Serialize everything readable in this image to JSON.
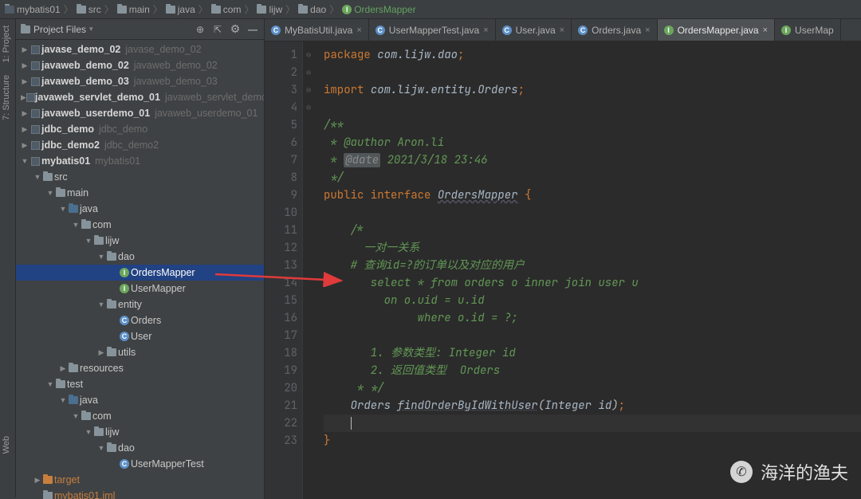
{
  "breadcrumbs": [
    "mybatis01",
    "src",
    "main",
    "java",
    "com",
    "lijw",
    "dao",
    "OrdersMapper"
  ],
  "leftTabs": [
    "1: Project",
    "7: Structure",
    "Web"
  ],
  "projectHeader": {
    "title": "Project Files"
  },
  "tree": [
    {
      "depth": 0,
      "arrow": "▶",
      "icon": "module",
      "name": "javase_demo_02",
      "hint": "javase_demo_02",
      "bold": true
    },
    {
      "depth": 0,
      "arrow": "▶",
      "icon": "module",
      "name": "javaweb_demo_02",
      "hint": "javaweb_demo_02",
      "bold": true
    },
    {
      "depth": 0,
      "arrow": "▶",
      "icon": "module",
      "name": "javaweb_demo_03",
      "hint": "javaweb_demo_03",
      "bold": true
    },
    {
      "depth": 0,
      "arrow": "▶",
      "icon": "module",
      "name": "javaweb_servlet_demo_01",
      "hint": "javaweb_servlet_demo",
      "bold": true
    },
    {
      "depth": 0,
      "arrow": "▶",
      "icon": "module",
      "name": "javaweb_userdemo_01",
      "hint": "javaweb_userdemo_01",
      "bold": true
    },
    {
      "depth": 0,
      "arrow": "▶",
      "icon": "module",
      "name": "jdbc_demo",
      "hint": "jdbc_demo",
      "bold": true
    },
    {
      "depth": 0,
      "arrow": "▶",
      "icon": "module",
      "name": "jdbc_demo2",
      "hint": "jdbc_demo2",
      "bold": true
    },
    {
      "depth": 0,
      "arrow": "▼",
      "icon": "module",
      "name": "mybatis01",
      "hint": "mybatis01",
      "bold": true
    },
    {
      "depth": 1,
      "arrow": "▼",
      "icon": "folder-generic",
      "name": "src"
    },
    {
      "depth": 2,
      "arrow": "▼",
      "icon": "folder-generic",
      "name": "main"
    },
    {
      "depth": 3,
      "arrow": "▼",
      "icon": "folder-blue",
      "name": "java"
    },
    {
      "depth": 4,
      "arrow": "▼",
      "icon": "folder-generic",
      "name": "com"
    },
    {
      "depth": 5,
      "arrow": "▼",
      "icon": "folder-generic",
      "name": "lijw"
    },
    {
      "depth": 6,
      "arrow": "▼",
      "icon": "folder-generic",
      "name": "dao"
    },
    {
      "depth": 7,
      "arrow": "",
      "icon": "interface",
      "name": "OrdersMapper",
      "selected": true
    },
    {
      "depth": 7,
      "arrow": "",
      "icon": "interface",
      "name": "UserMapper"
    },
    {
      "depth": 6,
      "arrow": "▼",
      "icon": "folder-generic",
      "name": "entity"
    },
    {
      "depth": 7,
      "arrow": "",
      "icon": "class",
      "name": "Orders"
    },
    {
      "depth": 7,
      "arrow": "",
      "icon": "class",
      "name": "User"
    },
    {
      "depth": 6,
      "arrow": "▶",
      "icon": "folder-generic",
      "name": "utils"
    },
    {
      "depth": 3,
      "arrow": "▶",
      "icon": "folder-generic",
      "name": "resources"
    },
    {
      "depth": 2,
      "arrow": "▼",
      "icon": "folder-generic",
      "name": "test"
    },
    {
      "depth": 3,
      "arrow": "▼",
      "icon": "folder-blue",
      "name": "java"
    },
    {
      "depth": 4,
      "arrow": "▼",
      "icon": "folder-generic",
      "name": "com"
    },
    {
      "depth": 5,
      "arrow": "▼",
      "icon": "folder-generic",
      "name": "lijw"
    },
    {
      "depth": 6,
      "arrow": "▼",
      "icon": "folder-generic",
      "name": "dao"
    },
    {
      "depth": 7,
      "arrow": "",
      "icon": "class",
      "name": "UserMapperTest"
    },
    {
      "depth": 1,
      "arrow": "▶",
      "icon": "folder-orange",
      "name": "target",
      "orange": true
    },
    {
      "depth": 1,
      "arrow": "",
      "icon": "folder-generic",
      "name": "mybatis01.iml",
      "orange": true
    }
  ],
  "tabs": [
    {
      "label": "MyBatisUtil.java",
      "icon": "class",
      "active": false
    },
    {
      "label": "UserMapperTest.java",
      "icon": "class",
      "active": false
    },
    {
      "label": "User.java",
      "icon": "class",
      "active": false
    },
    {
      "label": "Orders.java",
      "icon": "class",
      "active": false
    },
    {
      "label": "OrdersMapper.java",
      "icon": "interface",
      "active": true
    },
    {
      "label": "UserMap",
      "icon": "interface",
      "active": false,
      "noclose": true
    }
  ],
  "code": {
    "lines": [
      {
        "n": 1,
        "html": "<span class='kw'>package</span> <span class='pkg'>com.lijw.dao</span><span class='semi'>;</span>"
      },
      {
        "n": 2,
        "html": ""
      },
      {
        "n": 3,
        "html": "<span class='kw'>import</span> <span class='pkg'>com.lijw.entity.Orders</span><span class='semi'>;</span>"
      },
      {
        "n": 4,
        "html": ""
      },
      {
        "n": 5,
        "fold": "⊖",
        "html": "<span class='doc'>/**</span>"
      },
      {
        "n": 6,
        "html": "<span class='doc'> * @author Aron.li</span>"
      },
      {
        "n": 7,
        "html": "<span class='doc'> * <span class='tag'>@date</span> 2021/3/18 23:46</span>"
      },
      {
        "n": 8,
        "fold": "⊖",
        "html": "<span class='doc'> */</span>"
      },
      {
        "n": 9,
        "html": "<span class='kw'>public interface</span> <span class='cname'>OrdersMapper</span> <span class='punct'>{</span>"
      },
      {
        "n": 10,
        "html": ""
      },
      {
        "n": 11,
        "fold": "⊖",
        "html": "    <span class='cmt'>/*</span>"
      },
      {
        "n": 12,
        "html": "    <span class='cmt'>  一对一关系</span>"
      },
      {
        "n": 13,
        "html": "    <span class='cmt'># 查询id=?的订单以及对应的用户</span>"
      },
      {
        "n": 14,
        "html": "    <span class='cmt'>   select * from orders o inner join user u</span>"
      },
      {
        "n": 15,
        "html": "    <span class='cmt'>     on o.uid = u.id</span>"
      },
      {
        "n": 16,
        "html": "    <span class='cmt'>          where o.id = ?;</span>"
      },
      {
        "n": 17,
        "html": ""
      },
      {
        "n": 18,
        "html": "    <span class='cmt'>   1. 参数类型: Integer id</span>"
      },
      {
        "n": 19,
        "html": "    <span class='cmt'>   2. 返回值类型  Orders</span>"
      },
      {
        "n": 20,
        "html": "    <span class='cmt'> * */</span>"
      },
      {
        "n": 21,
        "html": "    <span class='type'>Orders</span> <span class='mname'>findOrderByIdWithUser</span>(<span class='param-type'>Integer</span> <span class='param'>id</span>)<span class='semi'>;</span>"
      },
      {
        "n": 22,
        "html": "    <span class='caret'></span>",
        "cursor": true
      },
      {
        "n": 23,
        "fold": "⊖",
        "html": "<span class='punct'>}</span>"
      }
    ]
  },
  "watermark": "海洋的渔夫"
}
